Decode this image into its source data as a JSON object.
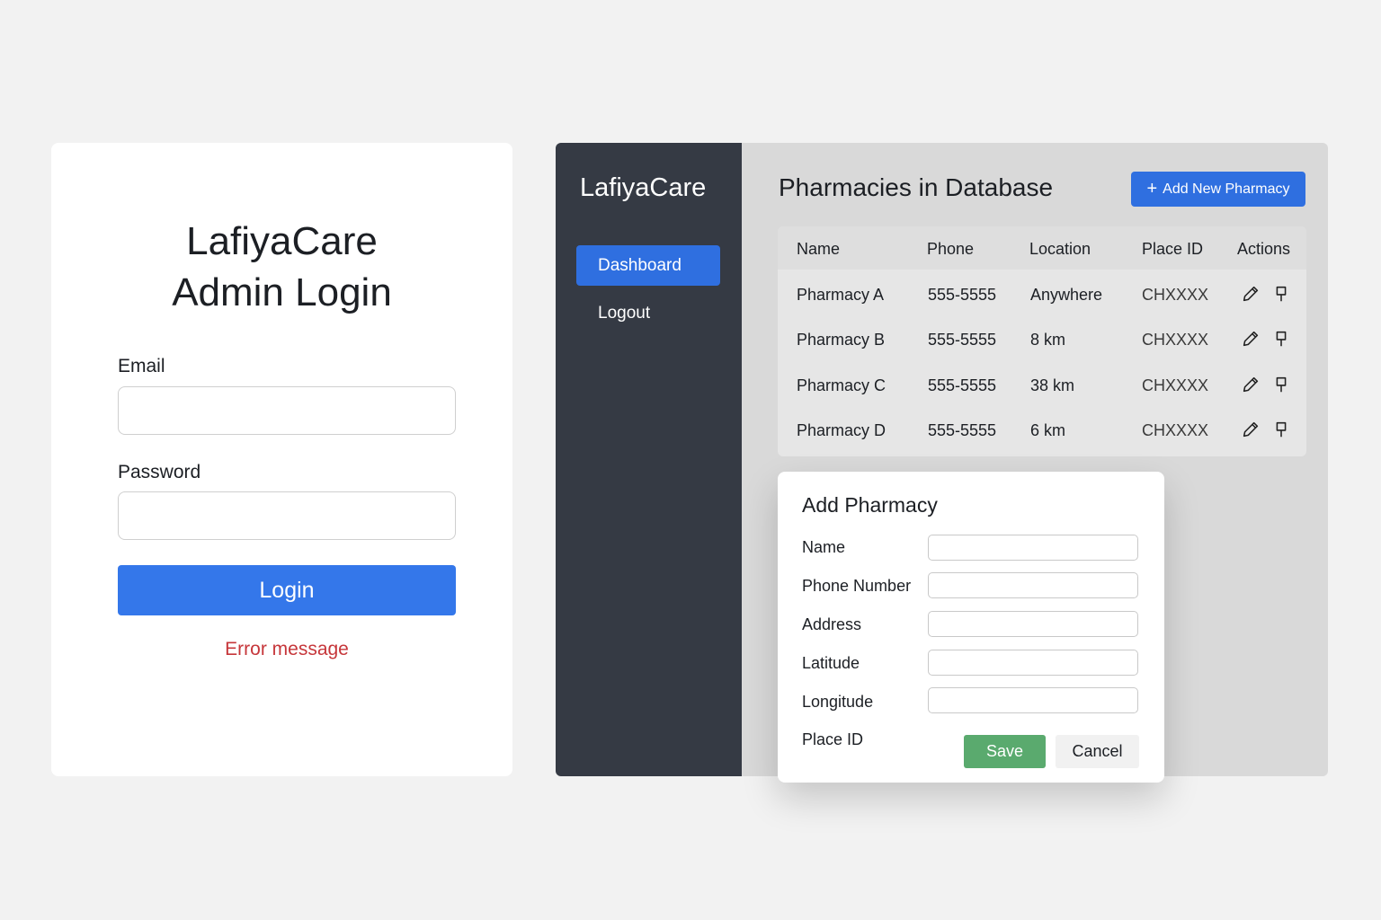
{
  "login": {
    "title_line1": "LafiyaCare",
    "title_line2": "Admin Login",
    "email_label": "Email",
    "email_value": "",
    "password_label": "Password",
    "password_value": "",
    "login_button": "Login",
    "error_message": "Error message"
  },
  "sidebar": {
    "brand": "LafiyaCare",
    "items": [
      {
        "label": "Dashboard",
        "active": true
      },
      {
        "label": "Logout",
        "active": false
      }
    ]
  },
  "main": {
    "title": "Pharmacies in Database",
    "add_button": "Add New Pharmacy",
    "add_button_icon": "plus-icon",
    "table": {
      "headers": [
        "Name",
        "Phone",
        "Location",
        "Place ID",
        "Actions"
      ],
      "rows": [
        {
          "name": "Pharmacy A",
          "phone": "555-5555",
          "location": "Anywhere",
          "place_id": "CHXXXX"
        },
        {
          "name": "Pharmacy B",
          "phone": "555-5555",
          "location": "8 km",
          "place_id": "CHXXXX"
        },
        {
          "name": "Pharmacy C",
          "phone": "555-5555",
          "location": "38 km",
          "place_id": "CHXXXX"
        },
        {
          "name": "Pharmacy D",
          "phone": "555-5555",
          "location": "6 km",
          "place_id": "CHXXXX"
        }
      ],
      "action_icons": [
        "pencil-icon",
        "pin-icon"
      ]
    }
  },
  "modal": {
    "title": "Add Pharmacy",
    "fields": [
      {
        "label": "Name",
        "value": ""
      },
      {
        "label": "Phone Number",
        "value": ""
      },
      {
        "label": "Address",
        "value": ""
      },
      {
        "label": "Latitude",
        "value": ""
      },
      {
        "label": "Longitude",
        "value": ""
      },
      {
        "label": "Place ID",
        "value": ""
      }
    ],
    "save_button": "Save",
    "cancel_button": "Cancel"
  },
  "colors": {
    "page_bg": "#f2f2f2",
    "primary": "#3477ea",
    "sidebar_bg": "#353a44",
    "error": "#c6363a",
    "save": "#5aaa6e"
  }
}
